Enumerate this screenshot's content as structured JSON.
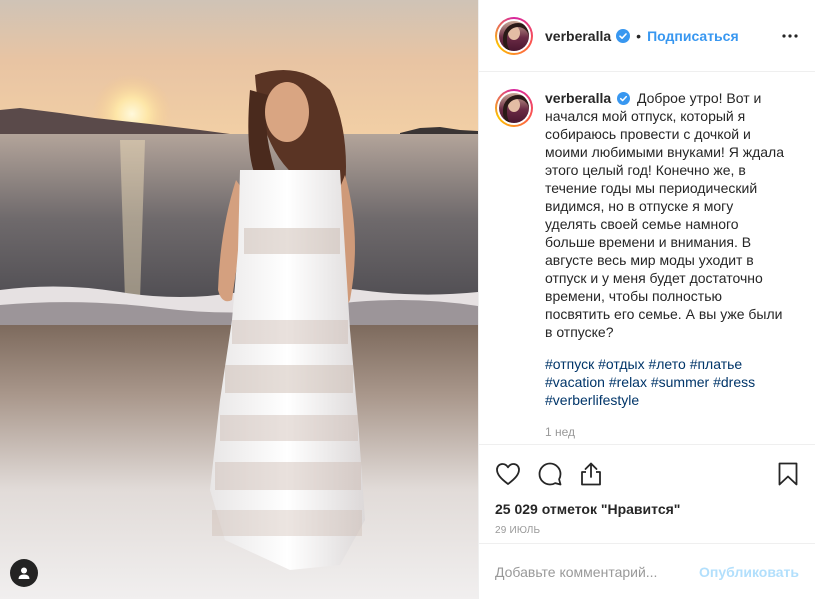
{
  "post": {
    "username": "verberalla",
    "follow_label": "Подписаться",
    "separator": "•",
    "caption": "Доброе утро! Вот и начался мой отпуск, который я собираюсь провести с дочкой и моими любимыми внуками! Я ждала этого целый год! Конечно же, в течение годы мы периодический видимся, но в отпуске я могу уделять своей семье намного больше времени и внимания. В августе весь мир моды уходит в отпуск и у меня будет достаточно времени, чтобы полностью посвятить его семье. А вы уже были в отпуске?",
    "hashtags": [
      "#отпуск",
      "#отдых",
      "#лето",
      "#платье",
      "#vacation",
      "#relax",
      "#summer",
      "#dress",
      "#verberlifestyle"
    ],
    "caption_time": "1 нед",
    "likes_text": "25 029 отметок \"Нравится\"",
    "date": "29 июль",
    "comment_placeholder": "Добавьте комментарий...",
    "post_button": "Опубликовать"
  },
  "colors": {
    "accent": "#3897f0",
    "hashtag": "#003569",
    "post_button_disabled": "#b2dffc",
    "muted": "#999999"
  },
  "icons": {
    "verified": "verified-badge-icon",
    "more": "more-options-icon",
    "like": "heart-icon",
    "comment": "comment-bubble-icon",
    "share": "share-icon",
    "save": "bookmark-icon",
    "user_tag": "user-tag-icon"
  }
}
